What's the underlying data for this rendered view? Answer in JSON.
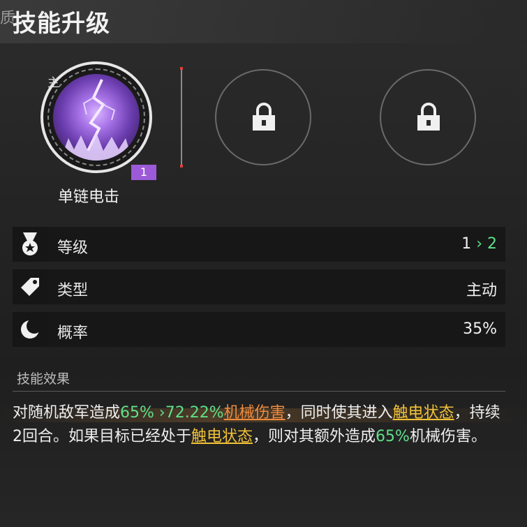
{
  "header": {
    "prefix": "质",
    "title": "技能升级"
  },
  "skills": {
    "main": {
      "tag": "主",
      "level": "1",
      "name": "单链电击"
    }
  },
  "stats": [
    {
      "label": "等级",
      "value_from": "1",
      "arrow": "›",
      "value_to": "2"
    },
    {
      "label": "类型",
      "value": "主动"
    },
    {
      "label": "概率",
      "value": "35%"
    }
  ],
  "effect": {
    "title": "技能效果",
    "p1": "对随机敌军造成",
    "pct_from": "65%",
    "arrow": "›",
    "pct_to": "72.22%",
    "dmg_type": "机械伤害",
    "p2": "，同时使其进入",
    "status1": "触电状态",
    "p3": "，持续2回合。如果目标已经处于",
    "status2": "触电状态",
    "p4": "，则对其额外造成",
    "extra_pct": "65%",
    "p5": "机械伤害。"
  },
  "colors": {
    "accent_green": "#5fe08a",
    "accent_orange": "#f08a3c",
    "accent_yellow": "#f2c238",
    "level_badge": "#9c5ad8"
  }
}
